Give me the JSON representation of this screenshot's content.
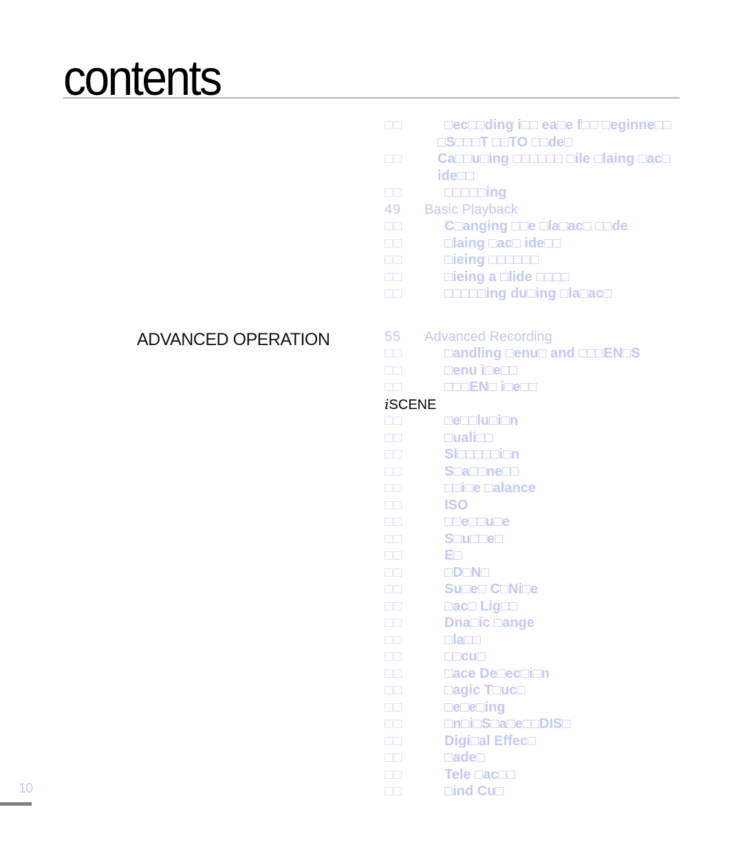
{
  "header": {
    "title": "contents"
  },
  "section": {
    "label": "ADVANCED OPERATION"
  },
  "toc_before": [
    {
      "type": "item",
      "num": "□□",
      "text": " □ec□□ding i□□ ea□e f□□ □eginne□□"
    },
    {
      "type": "item",
      "num": "",
      "text": "□S□□□T □□TO □□de□",
      "indent": "l2"
    },
    {
      "type": "item",
      "num": "□□",
      "text": "Ca□□u□ing □□□□□□ □ile □laing □ac□",
      "indent": "l2"
    },
    {
      "type": "item",
      "num": "",
      "text": "ide□□",
      "indent": "l2"
    },
    {
      "type": "item",
      "num": "□□",
      "text": " □□□□□ing"
    },
    {
      "type": "chapter",
      "num": "49",
      "text": "Basic Playback"
    },
    {
      "type": "item",
      "num": "□□",
      "text": " C□anging □□e □la□ac□ □□de"
    },
    {
      "type": "item",
      "num": "□□",
      "text": " □laing □ac□ ide□□"
    },
    {
      "type": "item",
      "num": "□□",
      "text": " □ieing □□□□□□"
    },
    {
      "type": "item",
      "num": "□□",
      "text": " □ieing a □lide □□□□"
    },
    {
      "type": "item",
      "num": "□□",
      "text": " □□□□□ing du□ing □la□ac□"
    }
  ],
  "toc_after": [
    {
      "type": "chapter",
      "num": "55",
      "text": "Advanced Recording"
    },
    {
      "type": "item",
      "num": "□□",
      "text": " □andling □enu□ and □□□EN□S"
    },
    {
      "type": "item",
      "num": "□□",
      "text": " □enu i□e□□"
    },
    {
      "type": "item",
      "num": "□□",
      "text": " □□□EN□ i□e□□"
    },
    {
      "type": "iscene",
      "num": "□□",
      "prefix": "i",
      "text": "SCENE"
    },
    {
      "type": "item",
      "num": "□□",
      "text": " □e□□lu□i□n"
    },
    {
      "type": "item",
      "num": "□□",
      "text": " □uali□□"
    },
    {
      "type": "item",
      "num": "□□",
      "text": " Sl□□□□□i□n"
    },
    {
      "type": "item",
      "num": "□□",
      "text": " S□a□□ne□□"
    },
    {
      "type": "item",
      "num": "□□",
      "text": " □□i□e □alance"
    },
    {
      "type": "item",
      "num": "□□",
      "text": " ISO"
    },
    {
      "type": "item",
      "num": "□□",
      "text": " □□e□□u□e"
    },
    {
      "type": "item",
      "num": "□□",
      "text": " S□u□□e□"
    },
    {
      "type": "item",
      "num": "□□",
      "text": " E□"
    },
    {
      "type": "item",
      "num": "□□",
      "text": " □D□N□"
    },
    {
      "type": "item",
      "num": "□□",
      "text": " Su□e□ C□Ni□e"
    },
    {
      "type": "item",
      "num": "□□",
      "text": " □ac□ Lig□□"
    },
    {
      "type": "item",
      "num": "□□",
      "text": " Dna□ic □ange"
    },
    {
      "type": "item",
      "num": "□□",
      "text": " □la□□"
    },
    {
      "type": "item",
      "num": "□□",
      "text": " □□cu□"
    },
    {
      "type": "item",
      "num": "□□",
      "text": " □ace De□ec□i□n"
    },
    {
      "type": "item",
      "num": "□□",
      "text": " □agic T□uc□"
    },
    {
      "type": "item",
      "num": "□□",
      "text": " □e□e□ing"
    },
    {
      "type": "item",
      "num": "□□",
      "text": " □n□i□S□a□e□□DIS□"
    },
    {
      "type": "item",
      "num": "□□",
      "text": " Digi□al Effec□"
    },
    {
      "type": "item",
      "num": "□□",
      "text": " □ade□"
    },
    {
      "type": "item",
      "num": "□□",
      "text": " Tele □ac□□"
    },
    {
      "type": "item",
      "num": "□□",
      "text": " □ind Cu□"
    }
  ],
  "footer": {
    "page_number": "10"
  }
}
